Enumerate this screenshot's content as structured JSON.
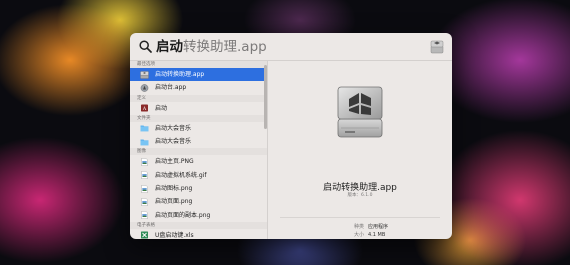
{
  "search": {
    "typed": "启动",
    "completion": "转换助理.app"
  },
  "sections": [
    {
      "header": "最佳选项",
      "items": [
        {
          "label": "启动转换助理.app",
          "icon": "bootcamp-app-icon",
          "selected": true
        },
        {
          "label": "启动台.app",
          "icon": "launchpad-app-icon",
          "selected": false
        }
      ]
    },
    {
      "header": "定义",
      "items": [
        {
          "label": "启动",
          "icon": "dictionary-icon",
          "selected": false
        }
      ]
    },
    {
      "header": "文件夹",
      "items": [
        {
          "label": "启动大会音乐",
          "icon": "folder-icon",
          "selected": false
        },
        {
          "label": "启动大会音乐",
          "icon": "folder-icon",
          "selected": false
        }
      ]
    },
    {
      "header": "图像",
      "items": [
        {
          "label": "启动主页.PNG",
          "icon": "image-file-icon",
          "selected": false
        },
        {
          "label": "启动虚拟机系统.gif",
          "icon": "image-file-icon",
          "selected": false
        },
        {
          "label": "启动图标.png",
          "icon": "image-file-icon",
          "selected": false
        },
        {
          "label": "启动页面.png",
          "icon": "image-file-icon",
          "selected": false
        },
        {
          "label": "启动页面的副本.png",
          "icon": "image-file-icon",
          "selected": false
        }
      ]
    },
    {
      "header": "电子表格",
      "items": [
        {
          "label": "U盘启动键.xls",
          "icon": "spreadsheet-icon",
          "selected": false
        }
      ]
    }
  ],
  "preview": {
    "name": "启动转换助理.app",
    "version": "版本：6.1.0",
    "info": [
      {
        "label": "种类",
        "value": "应用程序"
      },
      {
        "label": "大小",
        "value": "4.1 MB"
      },
      {
        "label": "创建时间",
        "value": "2018/8/18"
      },
      {
        "label": "修改时间",
        "value": "2019/5/31"
      },
      {
        "label": "上次打开时间",
        "value": "2019/9/16"
      }
    ]
  },
  "colors": {
    "selection": "#2d6fe0",
    "panel": "#ece8e6"
  }
}
